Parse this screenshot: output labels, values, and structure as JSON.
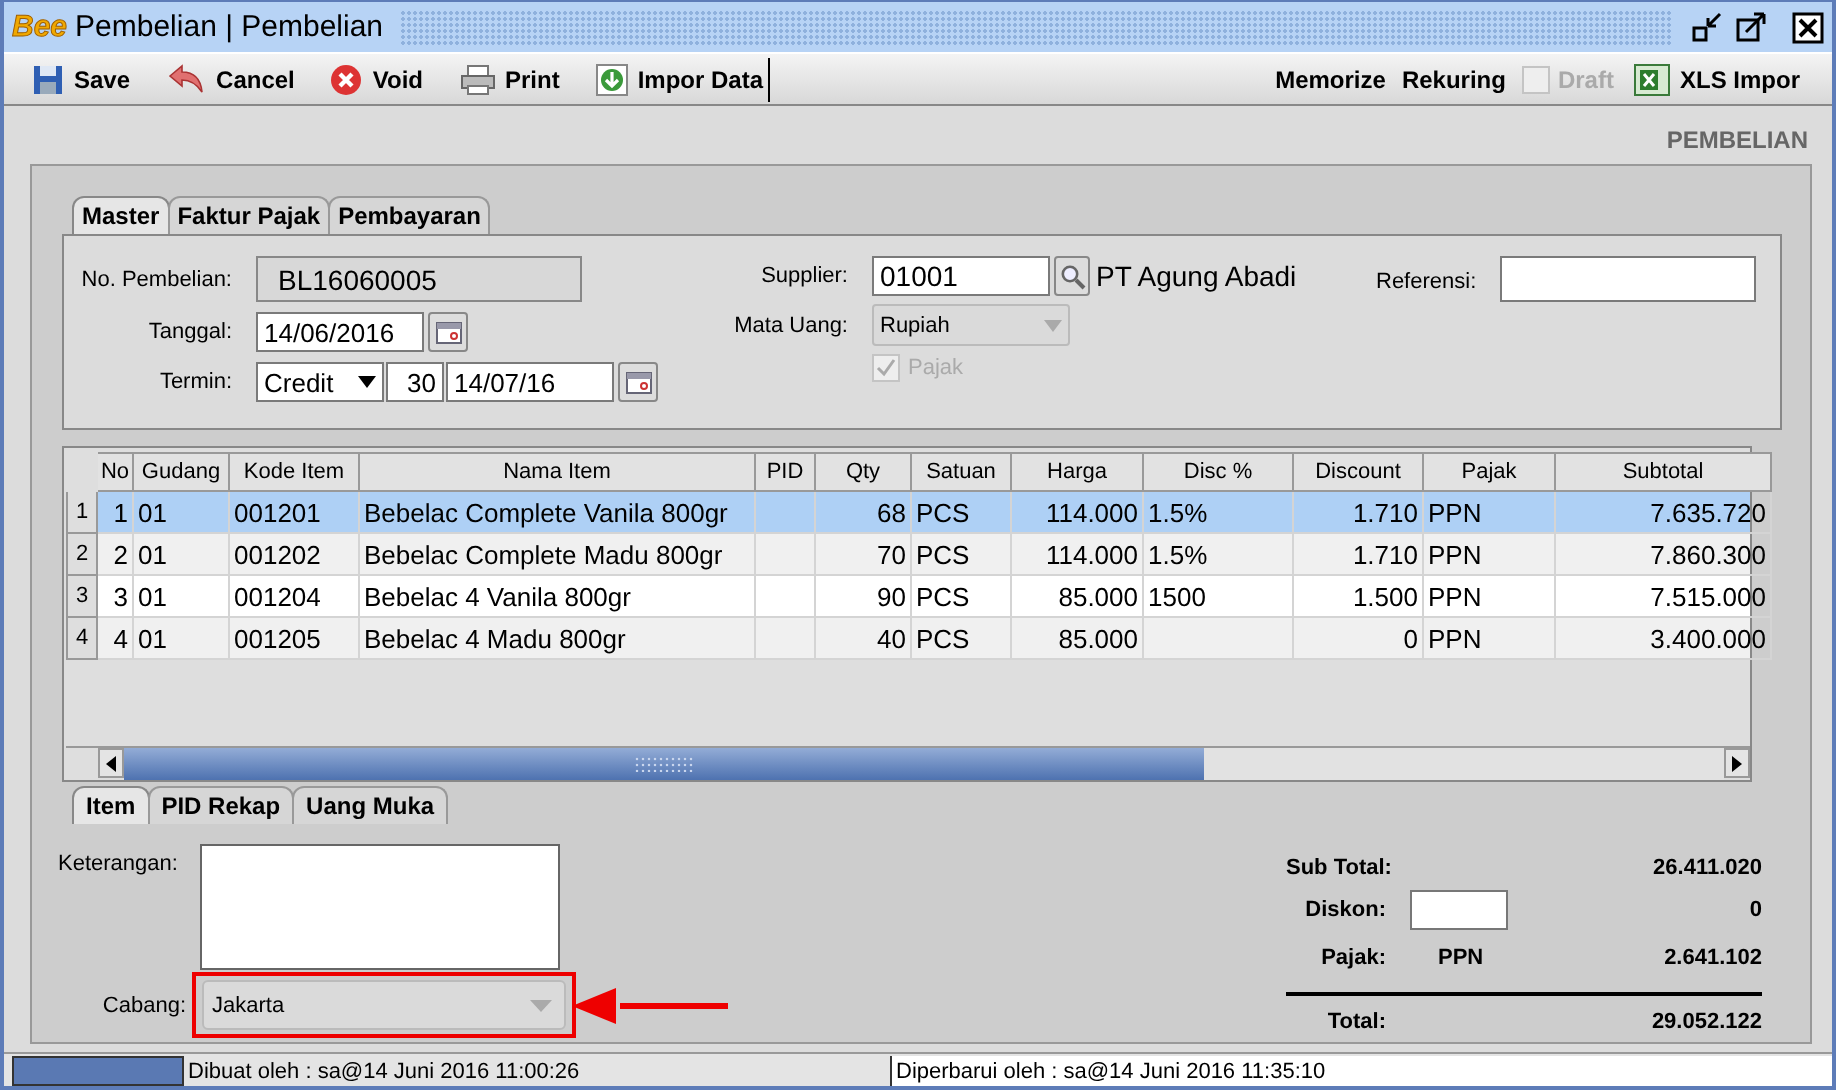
{
  "window": {
    "logo": "Bee",
    "title": "Pembelian | Pembelian"
  },
  "toolbar": {
    "left": [
      {
        "label": "Save"
      },
      {
        "label": "Cancel"
      },
      {
        "label": "Void"
      },
      {
        "label": "Print"
      },
      {
        "label": "Impor Data"
      }
    ],
    "memorize": "Memorize",
    "rekuring": "Rekuring",
    "draft": {
      "label": "Draft",
      "checked": false,
      "disabled": true
    },
    "xls": "XLS Impor"
  },
  "page_heading": "PEMBELIAN",
  "tabs": [
    {
      "label": "Master",
      "selected": true
    },
    {
      "label": "Faktur Pajak",
      "selected": false
    },
    {
      "label": "Pembayaran",
      "selected": false
    }
  ],
  "form": {
    "no_pembelian": {
      "label": "No. Pembelian:",
      "value": "BL16060005"
    },
    "tanggal": {
      "label": "Tanggal:",
      "value": "14/06/2016"
    },
    "termin": {
      "label": "Termin:",
      "value": "Credit",
      "days": "30",
      "due": "14/07/16"
    },
    "supplier": {
      "label": "Supplier:",
      "value": "01001",
      "name": "PT Agung Abadi"
    },
    "mata_uang": {
      "label": "Mata Uang:",
      "value": "Rupiah",
      "disabled": true
    },
    "pajak": {
      "label": "Pajak",
      "checked": true,
      "disabled": true
    },
    "referensi": {
      "label": "Referensi:"
    }
  },
  "table": {
    "columns": [
      {
        "label": "No"
      },
      {
        "label": "Gudang"
      },
      {
        "label": "Kode Item"
      },
      {
        "label": "Nama Item"
      },
      {
        "label": "PID"
      },
      {
        "label": "Qty"
      },
      {
        "label": "Satuan"
      },
      {
        "label": "Harga"
      },
      {
        "label": "Disc %"
      },
      {
        "label": "Discount"
      },
      {
        "label": "Pajak"
      },
      {
        "label": "Subtotal"
      }
    ],
    "rows": [
      {
        "header": "1",
        "selected": true,
        "cells": [
          "1",
          "01",
          "001201",
          "Bebelac Complete Vanila 800gr",
          "",
          "68",
          "PCS",
          "114.000",
          "1.5%",
          "1.710",
          "PPN",
          "7.635.720"
        ]
      },
      {
        "header": "2",
        "selected": false,
        "cells": [
          "2",
          "01",
          "001202",
          "Bebelac Complete Madu 800gr",
          "",
          "70",
          "PCS",
          "114.000",
          "1.5%",
          "1.710",
          "PPN",
          "7.860.300"
        ]
      },
      {
        "header": "3",
        "selected": false,
        "cells": [
          "3",
          "01",
          "001204",
          "Bebelac 4 Vanila 800gr",
          "",
          "90",
          "PCS",
          "85.000",
          "1500",
          "1.500",
          "PPN",
          "7.515.000"
        ]
      },
      {
        "header": "4",
        "selected": false,
        "cells": [
          "4",
          "01",
          "001205",
          "Bebelac 4 Madu 800gr",
          "",
          "40",
          "PCS",
          "85.000",
          "",
          "0",
          "PPN",
          "3.400.000"
        ]
      }
    ]
  },
  "bottom_tabs": [
    {
      "label": "Item",
      "selected": true
    },
    {
      "label": "PID Rekap",
      "selected": false
    },
    {
      "label": "Uang Muka",
      "selected": false
    }
  ],
  "keterangan": {
    "label": "Keterangan:"
  },
  "cabang": {
    "label": "Cabang:",
    "value": "Jakarta",
    "highlighted": true
  },
  "totals": {
    "sub_total": {
      "label": "Sub Total:",
      "value": "26.411.020"
    },
    "diskon": {
      "label": "Diskon:",
      "value": "0"
    },
    "pajak": {
      "label": "Pajak:",
      "tax": "PPN",
      "value": "2.641.102"
    },
    "total": {
      "label": "Total:",
      "value": "29.052.122"
    }
  },
  "status_bar": {
    "created": "Dibuat oleh : sa@14 Juni 2016  11:00:26",
    "updated": "Diperbarui oleh : sa@14 Juni 2016  11:35:10"
  }
}
